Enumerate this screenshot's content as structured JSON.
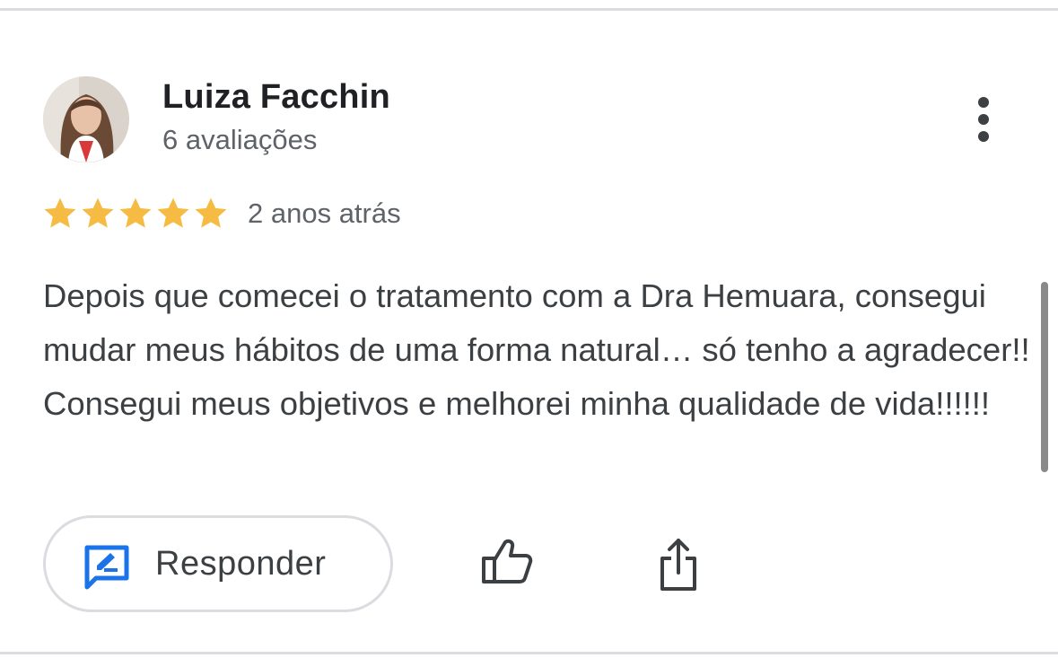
{
  "review": {
    "reviewer_name": "Luiza Facchin",
    "review_count": "6 avaliações",
    "rating": 5,
    "rating_max": 5,
    "time_ago": "2 anos atrás",
    "text": "Depois que comecei o tratamento com a Dra Hemuara, consegui mudar meus hábitos de uma forma natural… só tenho a agradecer!! Consegui meus objetivos e melhorei minha qualidade de vida!!!!!!"
  },
  "actions": {
    "reply_label": "Responder",
    "reply_icon": "reply-edit-icon",
    "like_icon": "thumbs-up-icon",
    "share_icon": "share-icon",
    "more_icon": "more-vertical-icon"
  },
  "colors": {
    "star": "#F6BB42",
    "reply_icon": "#1A73E8",
    "name": "#202124",
    "secondary_text": "#5F6368",
    "body_text": "#3C4043",
    "divider": "#DADCE0"
  }
}
